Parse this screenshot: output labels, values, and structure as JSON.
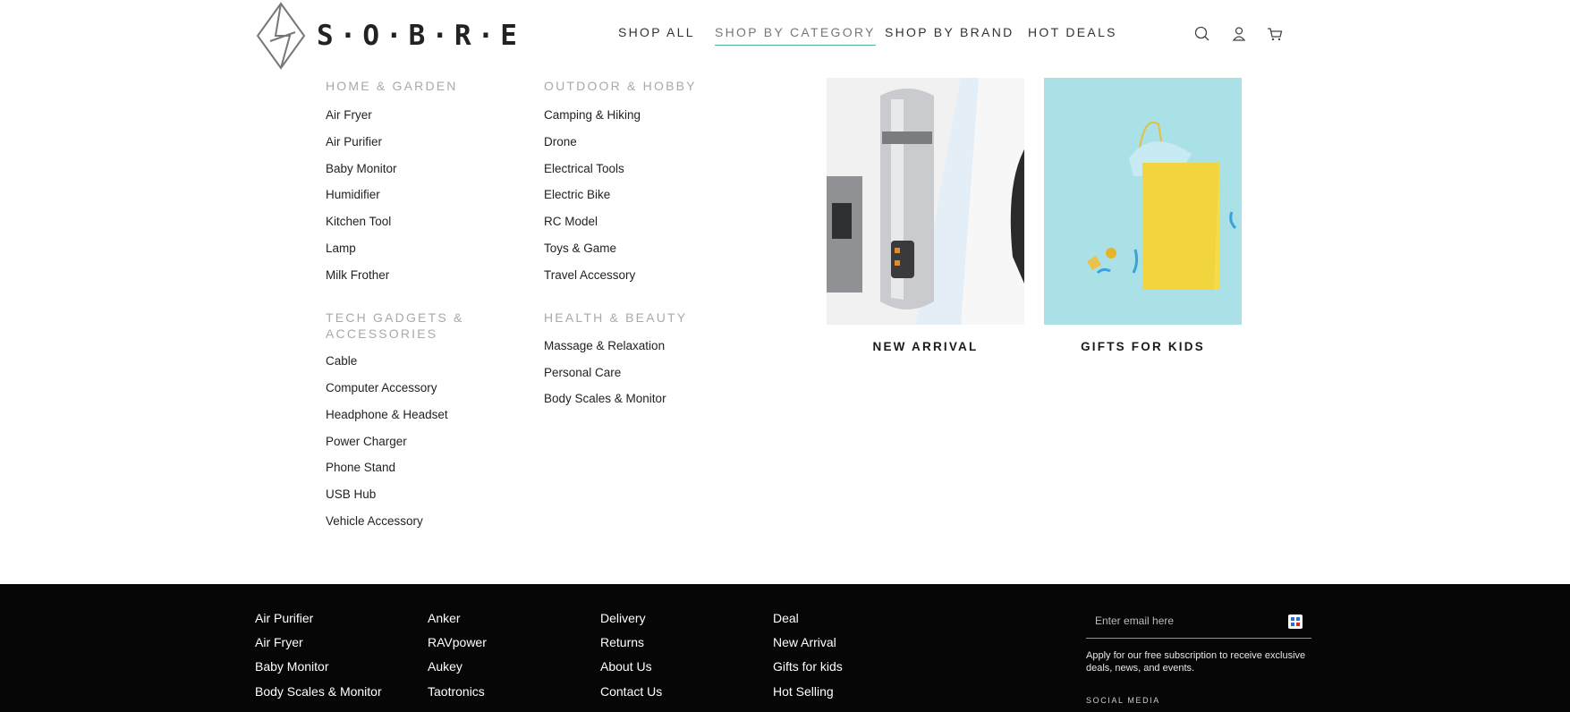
{
  "brand": {
    "name": "S·O·B·R·E"
  },
  "nav": {
    "shop_all": "SHOP ALL",
    "shop_by_category": "SHOP BY CATEGORY",
    "shop_by_brand": "SHOP BY BRAND",
    "hot_deals": "HOT DEALS",
    "active": "SHOP BY CATEGORY"
  },
  "header_icons": [
    "search-icon",
    "account-icon",
    "cart-icon"
  ],
  "menu": {
    "home_garden": {
      "title": "HOME & GARDEN",
      "items": [
        "Air Fryer",
        "Air Purifier",
        "Baby Monitor",
        "Humidifier",
        "Kitchen Tool",
        "Lamp",
        "Milk Frother"
      ]
    },
    "outdoor_hobby": {
      "title": "OUTDOOR & HOBBY",
      "items": [
        "Camping & Hiking",
        "Drone",
        "Electrical Tools",
        "Electric Bike",
        "RC Model",
        "Toys & Game",
        "Travel Accessory"
      ]
    },
    "tech_gadgets": {
      "title": "TECH GADGETS & ACCESSORIES",
      "items": [
        "Cable",
        "Computer Accessory",
        "Headphone & Headset",
        "Power Charger",
        "Phone Stand",
        "USB Hub",
        "Vehicle Accessory"
      ]
    },
    "health_beauty": {
      "title": "HEALTH & BEAUTY",
      "items": [
        "Massage & Relaxation",
        "Personal Care",
        "Body Scales & Monitor"
      ]
    }
  },
  "promos": [
    {
      "label": "NEW ARRIVAL"
    },
    {
      "label": "GIFTS FOR KIDS"
    }
  ],
  "footer": {
    "col1": [
      "Air Purifier",
      "Air Fryer",
      "Baby Monitor",
      "Body Scales & Monitor"
    ],
    "col2": [
      "Anker",
      "RAVpower",
      "Aukey",
      "Taotronics"
    ],
    "col3": [
      "Delivery",
      "Returns",
      "About Us",
      "Contact Us"
    ],
    "col4": [
      "Deal",
      "New Arrival",
      "Gifts for kids",
      "Hot Selling"
    ],
    "email_placeholder": "Enter email here",
    "subscribe_text": "Apply for our free subscription to receive exclusive deals, news, and events.",
    "social_heading": "SOCIAL MEDIA"
  },
  "colors": {
    "accent": "#4fb59a",
    "footer_bg": "#060606",
    "promo_kids_bg": "#a9e1e6",
    "bag": "#f5dc4f"
  }
}
